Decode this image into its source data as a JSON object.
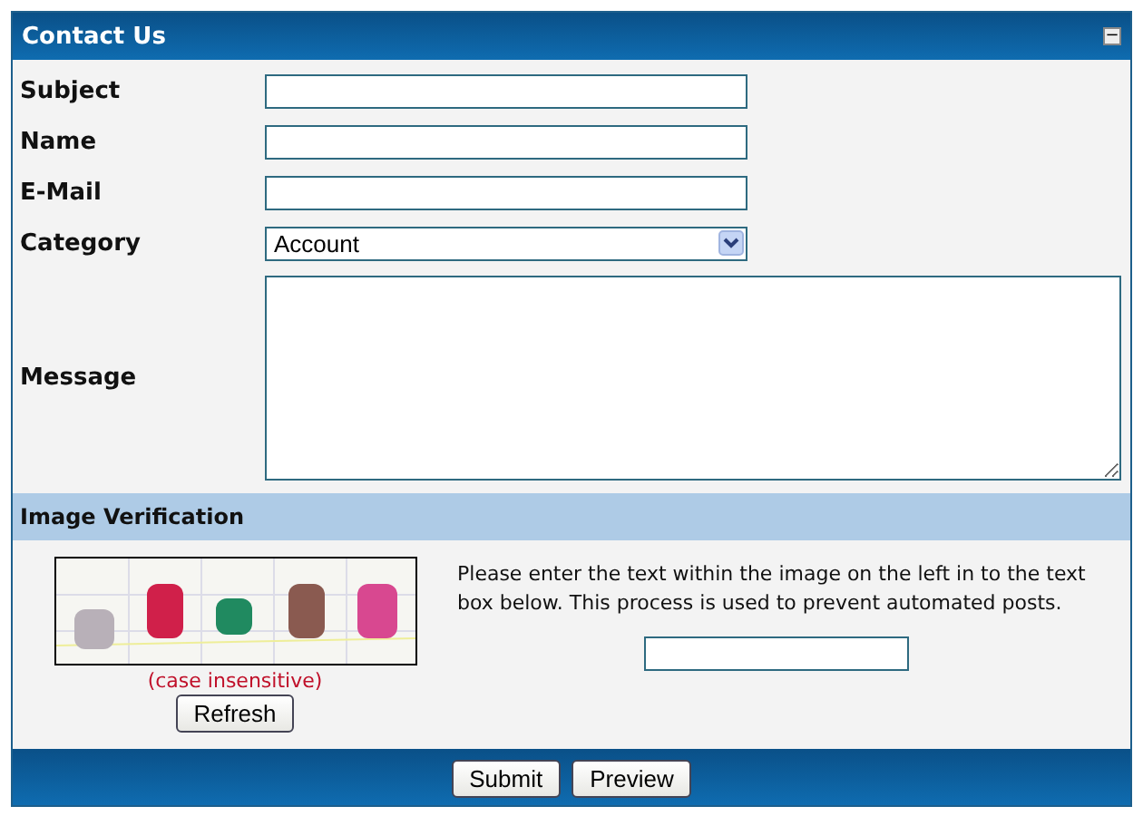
{
  "panel": {
    "title": "Contact Us",
    "collapse_icon": "−"
  },
  "fields": [
    {
      "label": "Subject",
      "kind": "text"
    },
    {
      "label": "Name",
      "kind": "text"
    },
    {
      "label": "E-Mail",
      "kind": "text"
    },
    {
      "label": "Category",
      "kind": "select",
      "value": "Account"
    },
    {
      "label": "Message",
      "kind": "textarea"
    }
  ],
  "verification": {
    "title": "Image Verification",
    "note": "(case insensitive)",
    "refresh_button": "Refresh",
    "instructions": "Please enter the text within the image on the left in to the text box below. This process is used to prevent automated posts."
  },
  "buttons": [
    "Submit",
    "Preview"
  ]
}
